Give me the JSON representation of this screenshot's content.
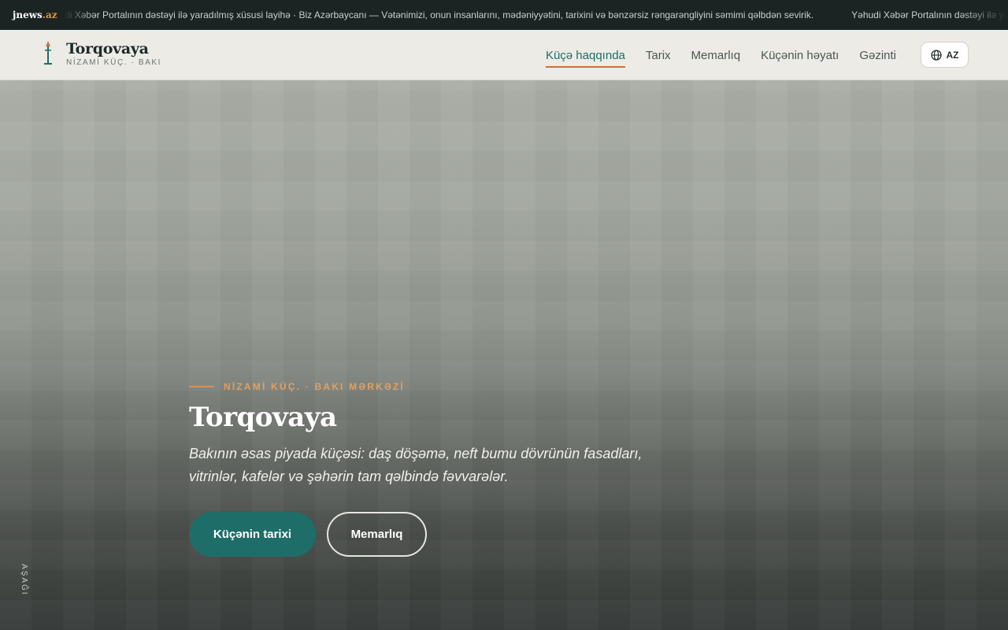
{
  "ticker": {
    "brand_name": "jnews",
    "brand_tld": ".az",
    "items": [
      "Yəhudi Xəbər Portalının dəstəyi ilə yaradılmış xüsusi layihə · Biz Azərbaycanı — Vətənimizi, onun insanlarını, mədəniyyətini, tarixini və bənzərsiz rəngarəngliyini səmimi qəlbdən sevirik.",
      "Yəhudi Xəbər Portalının dəstəyi ilə yaradılmış xüsusi layihə"
    ]
  },
  "header": {
    "logo_title": "Torqovaya",
    "logo_subtitle": "NİZAMİ KÜÇ. · BAKI",
    "nav": [
      {
        "label": "Küçə haqqında",
        "active": true
      },
      {
        "label": "Tarix",
        "active": false
      },
      {
        "label": "Memarlıq",
        "active": false
      },
      {
        "label": "Küçənin həyatı",
        "active": false
      },
      {
        "label": "Gəzinti",
        "active": false
      }
    ],
    "language": "AZ"
  },
  "hero": {
    "eyebrow": "NİZAMİ KÜÇ. · BAKI MƏRKƏZİ",
    "title": "Torqovaya",
    "lead": "Bakının əsas piyada küçəsi: daş döşəmə, neft bumu dövrünün fasadları, vitrinlər, kafelər və şəhərin tam qəlbində fəvvarələr.",
    "primary_button": "Küçənin tarixi",
    "secondary_button": "Memarlıq",
    "scroll_label": "AŞAĞI"
  },
  "colors": {
    "accent_teal": "#1f6d68",
    "accent_orange": "#c7743f",
    "ticker_bg": "#1b2423",
    "nav_bg": "#ecebe5"
  }
}
